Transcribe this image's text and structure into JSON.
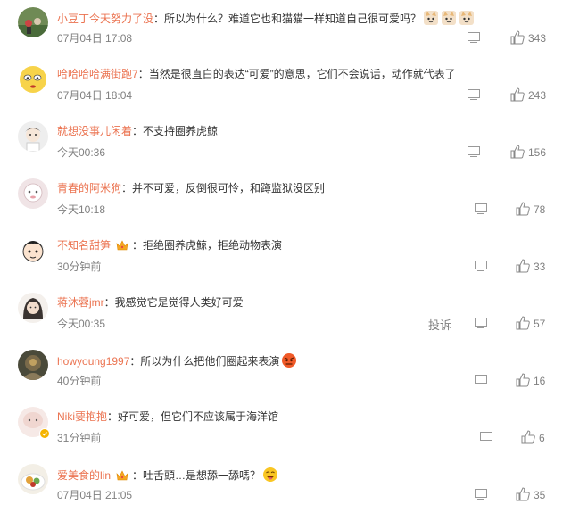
{
  "comments": [
    {
      "user": "小豆丁今天努力了没",
      "text": "：所以为什么？难道它也和猫猫一样知道自己很可爱吗？",
      "time": "07月04日 17:08",
      "likes": "343",
      "crown": false,
      "emoji": "cat-face"
    },
    {
      "user": "哈哈哈哈满街跑7",
      "text": "：当然是很直白的表达“可爱”的意思，它们不会说话，动作就代表了",
      "time": "07月04日 18:04",
      "likes": "243",
      "crown": false
    },
    {
      "user": "就想没事儿闲着",
      "text": "：不支持圈养虎鲸",
      "time": "今天00:36",
      "likes": "156",
      "crown": false
    },
    {
      "user": "青春的阿米狗",
      "text": "：并不可爱，反倒很可怜，和蹲监狱没区别",
      "time": "今天10:18",
      "likes": "78",
      "crown": false
    },
    {
      "user": "不知名甜笋",
      "text": "：拒绝圈养虎鲸，拒绝动物表演",
      "time": "30分钟前",
      "likes": "33",
      "crown": true
    },
    {
      "user": "蒋沐蓉jmr",
      "text": "：我感觉它是觉得人类好可爱",
      "time": "今天00:35",
      "likes": "57",
      "crown": false,
      "report": "投诉"
    },
    {
      "user": "howyoung1997",
      "text": "：所以为什么把他们圈起来表演",
      "time": "40分钟前",
      "likes": "16",
      "crown": false,
      "emoji": "angry-face"
    },
    {
      "user": "Niki要抱抱",
      "text": "：好可爱，但它们不应该属于海洋馆",
      "time": "31分钟前",
      "likes": "6",
      "crown": false
    },
    {
      "user": "爱美食的lin",
      "text": "：吐舌頭…是想舔一舔嗎？",
      "time": "07月04日 21:05",
      "likes": "35",
      "crown": true,
      "emoji": "laughing-face"
    }
  ]
}
